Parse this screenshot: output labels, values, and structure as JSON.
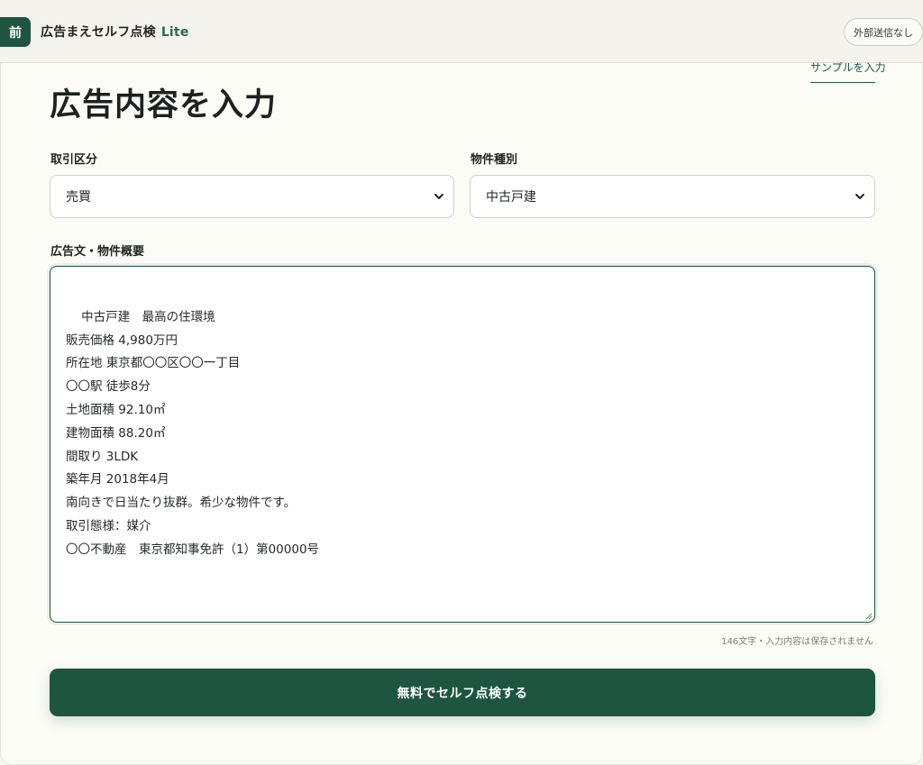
{
  "header": {
    "badge": "前",
    "title": "広告まえセルフ点検",
    "edition": "Lite",
    "privacy_label": "外部送信なし"
  },
  "sample_link": "サンプルを入力",
  "page_title": "広告内容を入力",
  "fields": {
    "transaction": {
      "label": "取引区分",
      "value": "売買"
    },
    "property": {
      "label": "物件種別",
      "value": "中古戸建"
    },
    "ad_text": {
      "label": "広告文・物件概要",
      "value": "中古戸建　最高の住環境\n販売価格 4,980万円\n所在地 東京都〇〇区〇〇一丁目\n〇〇駅 徒歩8分\n土地面積 92.10㎡\n建物面積 88.20㎡\n間取り 3LDK\n築年月 2018年4月\n南向きで日当たり抜群。希少な物件です。\n取引態様：媒介\n〇〇不動産　東京都知事免許（1）第00000号"
    }
  },
  "char_count_note": "146文字・入力内容は保存されません",
  "submit_label": "無料でセルフ点検する",
  "colors": {
    "brand": "#1d5540",
    "background": "#f6f6f1",
    "card": "#fcfcf7"
  }
}
